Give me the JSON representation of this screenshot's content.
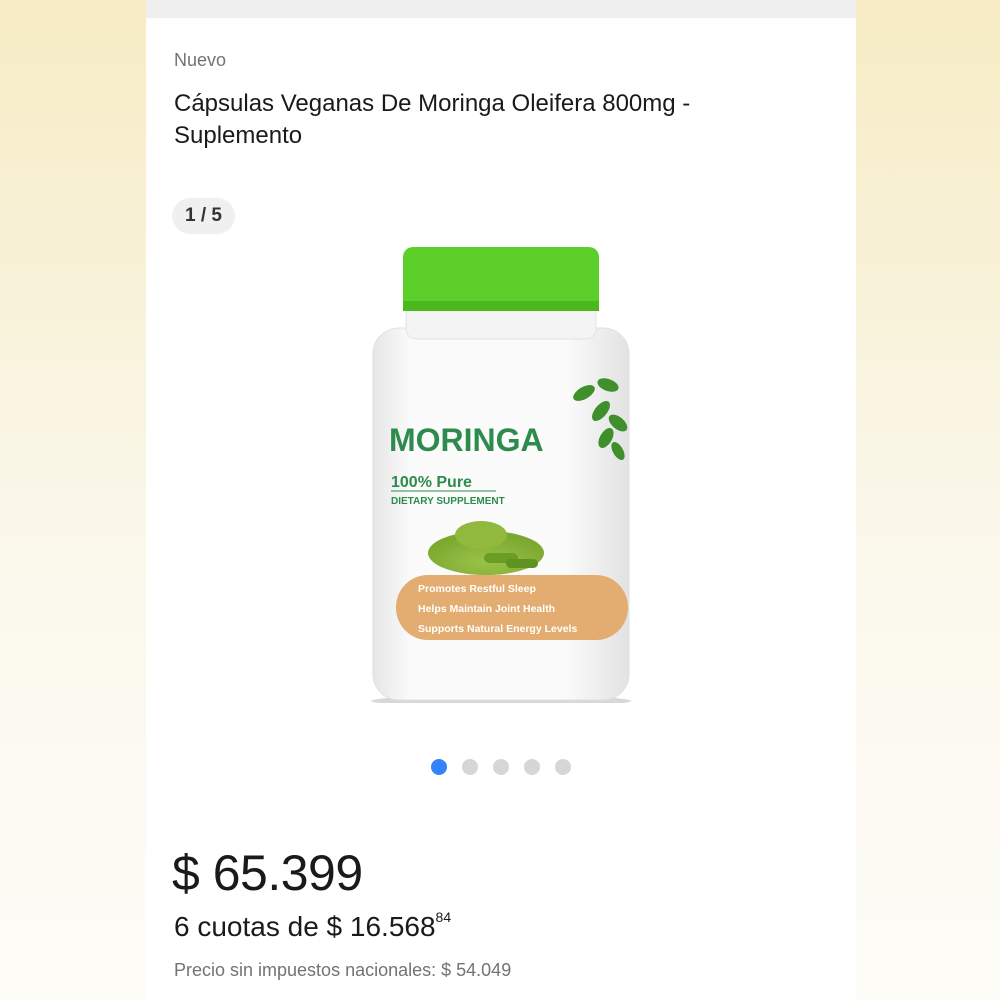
{
  "listing": {
    "condition": "Nuevo",
    "title": "Cápsulas Veganas De Moringa Oleifera 800mg - Suplemento",
    "gallery": {
      "counter": "1 / 5",
      "current": 1,
      "total": 5
    },
    "product_label": {
      "brand": "MORINGA",
      "purity": "100% Pure",
      "subtitle": "DIETARY SUPPLEMENT",
      "benefits": [
        "Promotes Restful Sleep",
        "Helps Maintain Joint Health",
        "Supports Natural Energy Levels"
      ]
    },
    "price": {
      "main": "$ 65.399",
      "installments_prefix": "6 cuotas de $ 16.568",
      "installments_cents": "84",
      "tax_note": "Precio sin impuestos nacionales: $ 54.049"
    }
  },
  "colors": {
    "cap_green": "#5ccf2a",
    "label_green": "#2e8b4e",
    "benefit_band": "#e3ad71",
    "active_dot": "#3483fa",
    "inactive_dot": "#d6d6d6",
    "muted_text": "#737373"
  }
}
